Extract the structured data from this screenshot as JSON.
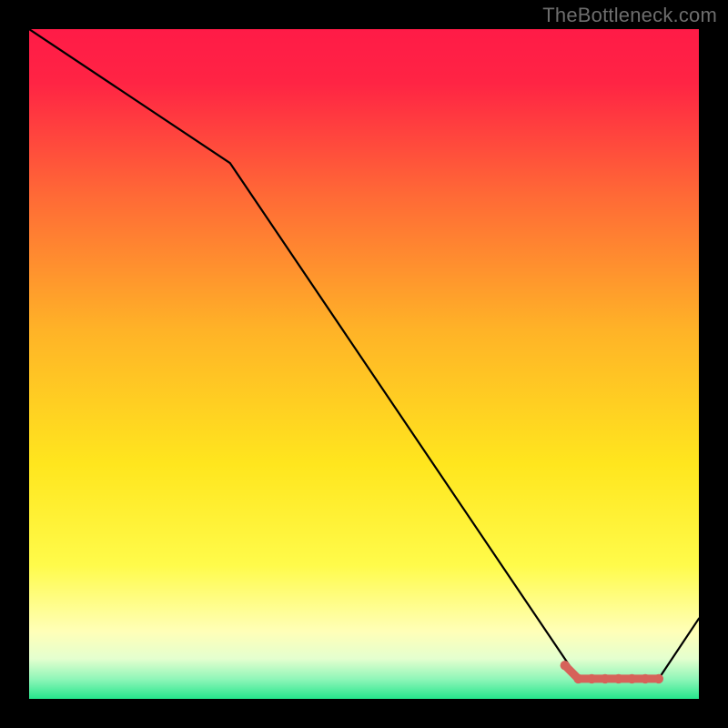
{
  "watermark": "TheBottleneck.com",
  "chart_data": {
    "type": "line",
    "title": "",
    "xlabel": "",
    "ylabel": "",
    "xlim": [
      0,
      100
    ],
    "ylim": [
      0,
      100
    ],
    "grid": false,
    "legend": false,
    "series": [
      {
        "name": "main-curve",
        "type": "line",
        "color": "#000000",
        "x": [
          0,
          30,
          82,
          94,
          100
        ],
        "values": [
          100,
          80,
          3,
          3,
          12
        ]
      },
      {
        "name": "highlight-segment",
        "type": "line",
        "color": "#d6625a",
        "x": [
          80,
          82,
          84,
          86,
          88,
          90,
          92,
          94
        ],
        "values": [
          5,
          3,
          3,
          3,
          3,
          3,
          3,
          3
        ]
      }
    ],
    "background_gradient_stops": [
      {
        "pos": 0.0,
        "color": "#ff1b47"
      },
      {
        "pos": 0.08,
        "color": "#ff2444"
      },
      {
        "pos": 0.25,
        "color": "#ff6a36"
      },
      {
        "pos": 0.45,
        "color": "#ffb327"
      },
      {
        "pos": 0.65,
        "color": "#ffe61e"
      },
      {
        "pos": 0.8,
        "color": "#fffb4a"
      },
      {
        "pos": 0.9,
        "color": "#ffffb8"
      },
      {
        "pos": 0.94,
        "color": "#e4ffcf"
      },
      {
        "pos": 0.97,
        "color": "#91f6b9"
      },
      {
        "pos": 1.0,
        "color": "#25e68c"
      }
    ]
  }
}
